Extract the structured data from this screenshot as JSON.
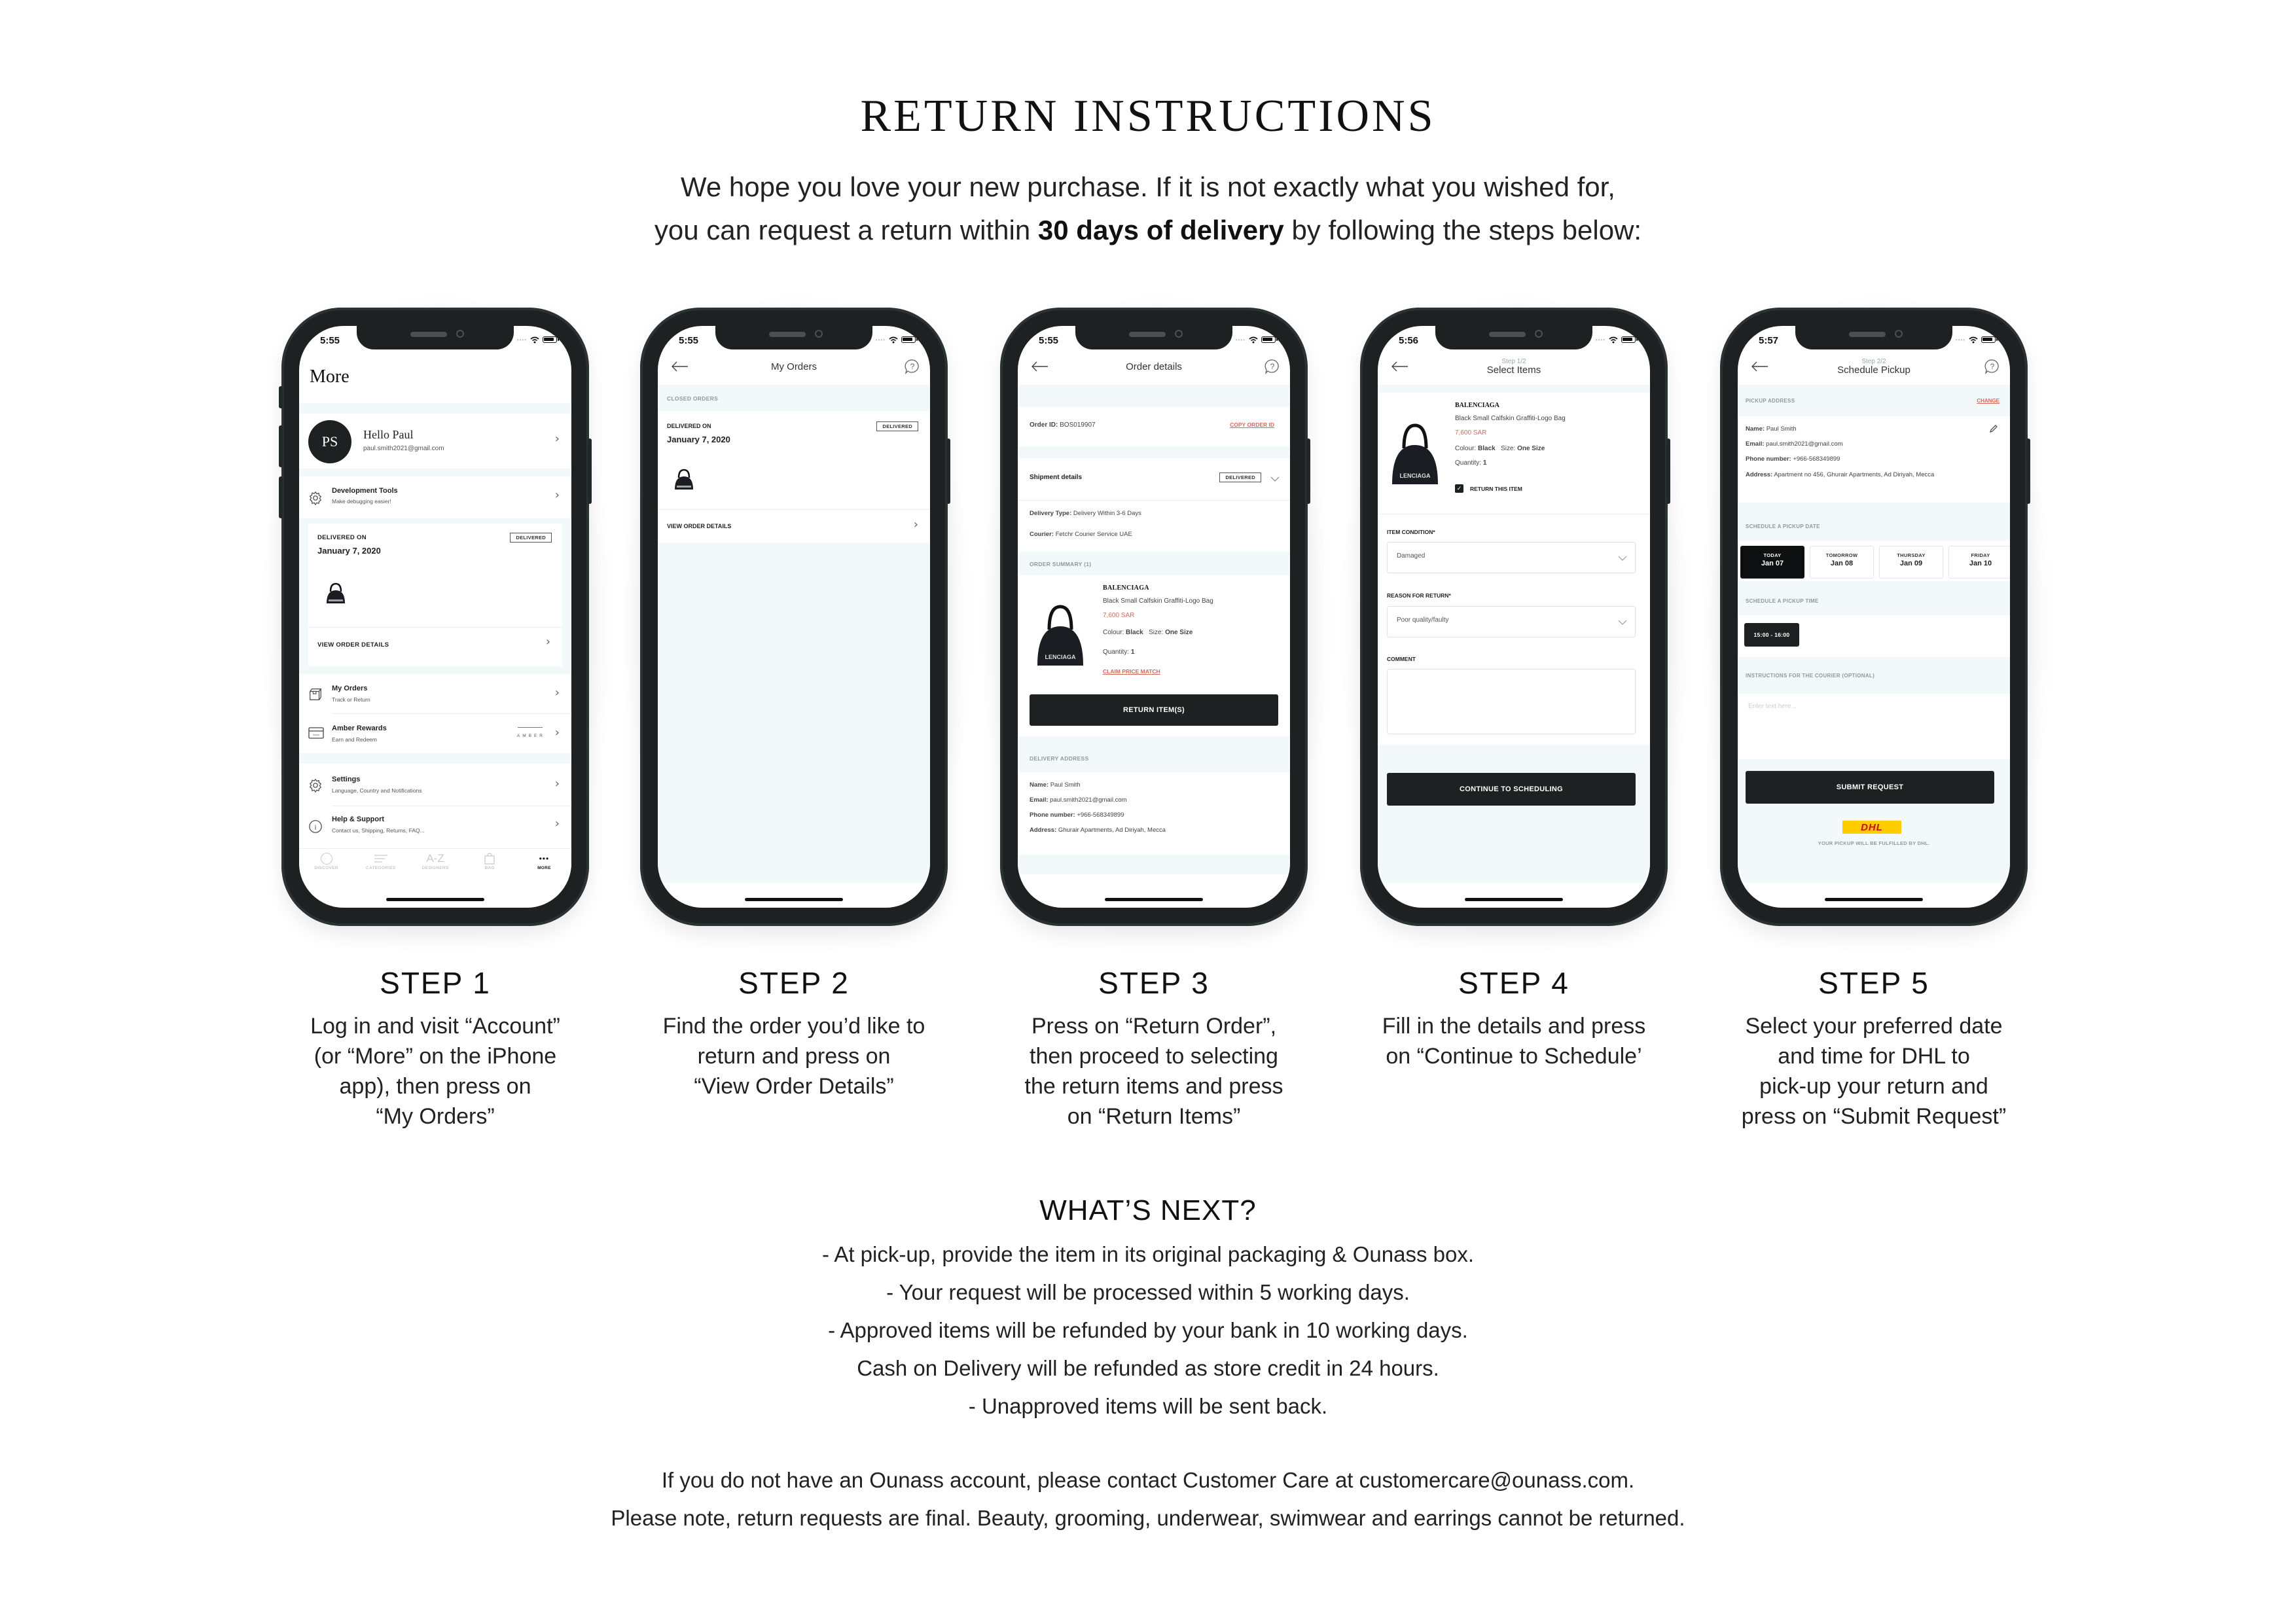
{
  "header": {
    "title": "RETURN INSTRUCTIONS",
    "intro_line1": "We hope you love your new purchase. If it is not exactly what you wished for,",
    "intro_line2_pre": "you can request a return within ",
    "intro_line2_bold": "30 days of delivery",
    "intro_line2_post": " by following the steps below:"
  },
  "colors": {
    "accent_red": "#d46a5d",
    "dark": "#1d2122",
    "section_tint": "#f3f9fb",
    "dhl_yellow": "#ffcc00",
    "dhl_red": "#d40511"
  },
  "status_bar_icons": [
    "signal-dots-icon",
    "wifi-icon",
    "battery-icon"
  ],
  "steps": [
    {
      "title": "STEP 1",
      "description": "Log in and visit “Account”\n(or “More” on the iPhone\napp), then press on\n“My Orders”"
    },
    {
      "title": "STEP 2",
      "description": "Find the order you’d like to\nreturn and press on\n“View Order Details”"
    },
    {
      "title": "STEP 3",
      "description": "Press on “Return Order”,\nthen proceed to selecting\nthe return items and press\non “Return Items”"
    },
    {
      "title": "STEP 4",
      "description": "Fill in the details and press\non “Continue to Schedule’"
    },
    {
      "title": "STEP 5",
      "description": "Select your preferred date\nand time for DHL to\npick-up your return and\npress on “Submit Request”"
    }
  ],
  "screen1": {
    "time": "5:55",
    "title": "More",
    "profile": {
      "initials": "PS",
      "greeting": "Hello Paul",
      "email": "paul.smith2021@gmail.com"
    },
    "dev_tools": {
      "title": "Development Tools",
      "subtitle": "Make debugging easier!"
    },
    "order_card": {
      "delivered_label": "DELIVERED ON",
      "date": "January 7, 2020",
      "badge": "DELIVERED",
      "view_details": "VIEW ORDER DETAILS"
    },
    "menu": [
      {
        "title": "My Orders",
        "subtitle": "Track or Return",
        "icon": "box-icon"
      },
      {
        "title": "Amber Rewards",
        "subtitle": "Earn and Redeem",
        "icon": "card-icon",
        "logo": "AMBER"
      },
      {
        "title": "Settings",
        "subtitle": "Language, Country and Notifications",
        "icon": "gear-icon"
      },
      {
        "title": "Help & Support",
        "subtitle": "Contact us, Shipping, Returns, FAQ...",
        "icon": "info-icon"
      }
    ],
    "tabs": [
      {
        "label": "DISCOVER",
        "icon": "circle-icon",
        "active": false
      },
      {
        "label": "CATEGORIES",
        "icon": "lines-icon",
        "active": false
      },
      {
        "label": "DESIGNERS",
        "icon": "az-icon",
        "glyph": "A-Z",
        "active": false
      },
      {
        "label": "BAG",
        "icon": "bag-icon",
        "active": false
      },
      {
        "label": "MORE",
        "icon": "more-dots-icon",
        "glyph": "•••",
        "active": true
      }
    ]
  },
  "screen2": {
    "time": "5:55",
    "title": "My Orders",
    "section": "CLOSED ORDERS",
    "delivered_label": "DELIVERED ON",
    "date": "January 7, 2020",
    "badge": "DELIVERED",
    "view_details": "VIEW ORDER DETAILS"
  },
  "screen3": {
    "time": "5:55",
    "title": "Order details",
    "order_id_label": "Order ID:",
    "order_id": "BOS019907",
    "copy_order_id": "COPY ORDER ID",
    "shipment_label": "Shipment details",
    "badge": "DELIVERED",
    "delivery_type_label": "Delivery Type:",
    "delivery_type": "Delivery Within 3-6 Days",
    "courier_label": "Courier:",
    "courier": "Fetchr Courier Service UAE",
    "order_summary": "ORDER SUMMARY (1)",
    "product": {
      "brand": "BALENCIAGA",
      "name": "Black Small Calfskin Graffiti-Logo Bag",
      "price": "7,600 SAR",
      "colour_label": "Colour:",
      "colour": "Black",
      "size_label": "Size:",
      "size": "One Size",
      "quantity_label": "Quantity:",
      "quantity": "1",
      "claim": "CLAIM PRICE MATCH"
    },
    "return_button": "RETURN ITEM(S)",
    "delivery_address_label": "DELIVERY ADDRESS",
    "address": {
      "name_label": "Name:",
      "name": "Paul Smith",
      "email_label": "Email:",
      "email": "paul.smith2021@gmail.com",
      "phone_label": "Phone number:",
      "phone": "+966-568349899",
      "address_label": "Address:",
      "address": "Ghurair Apartments, Ad Diriyah, Mecca"
    }
  },
  "screen4": {
    "time": "5:56",
    "step": "Step 1/2",
    "title": "Select Items",
    "product": {
      "brand": "BALENCIAGA",
      "name": "Black Small Calfskin Graffiti-Logo Bag",
      "price": "7,600 SAR",
      "colour_label": "Colour:",
      "colour": "Black",
      "size_label": "Size:",
      "size": "One Size",
      "quantity_label": "Quantity:",
      "quantity": "1"
    },
    "return_checkbox_label": "RETURN THIS ITEM",
    "return_checked": true,
    "condition_label": "ITEM CONDITION*",
    "condition_value": "Damaged",
    "reason_label": "REASON FOR RETURN*",
    "reason_value": "Poor quality/faulty",
    "comment_label": "COMMENT",
    "comment_value": "",
    "continue_button": "CONTINUE TO SCHEDULING"
  },
  "screen5": {
    "time": "5:57",
    "step": "Step 2/2",
    "title": "Schedule Pickup",
    "pickup_address_label": "PICKUP ADDRESS",
    "change": "CHANGE",
    "address": {
      "name_label": "Name:",
      "name": "Paul Smith",
      "email_label": "Email:",
      "email": "paul.smith2021@gmail.com",
      "phone_label": "Phone number:",
      "phone": "+966-568349899",
      "address_label": "Address:",
      "address": "Apartment no 456, Ghurair Apartments, Ad Diriyah, Mecca"
    },
    "date_label": "SCHEDULE A PICKUP DATE",
    "dates": [
      {
        "day": "TODAY",
        "date": "Jan 07",
        "selected": true
      },
      {
        "day": "TOMORROW",
        "date": "Jan 08",
        "selected": false
      },
      {
        "day": "THURSDAY",
        "date": "Jan 09",
        "selected": false
      },
      {
        "day": "FRIDAY",
        "date": "Jan 10",
        "selected": false
      }
    ],
    "time_label": "SCHEDULE A PICKUP TIME",
    "time_slot": "15:00 - 16:00",
    "instructions_label": "INSTRUCTIONS FOR THE COURIER (OPTIONAL)",
    "instructions_placeholder": "Enter text here...",
    "submit_button": "SUBMIT REQUEST",
    "dhl_logo_text": "DHL",
    "dhl_note": "YOUR PICKUP WILL BE FULFILLED BY DHL."
  },
  "whats_next": {
    "title": "WHAT’S NEXT?",
    "lines": [
      "- At pick-up, provide the item in its original packaging & Ounass box.",
      "- Your request will be processed within 5 working days.",
      "- Approved items will be refunded by your bank in 10 working days.",
      "Cash on Delivery will be refunded as store credit in 24 hours.",
      "- Unapproved items will be sent back."
    ]
  },
  "footer": {
    "line1": "If you do not have an Ounass account, please contact Customer Care at customercare@ounass.com.",
    "line2": "Please note, return requests are final. Beauty, grooming, underwear, swimwear and earrings cannot be returned."
  }
}
